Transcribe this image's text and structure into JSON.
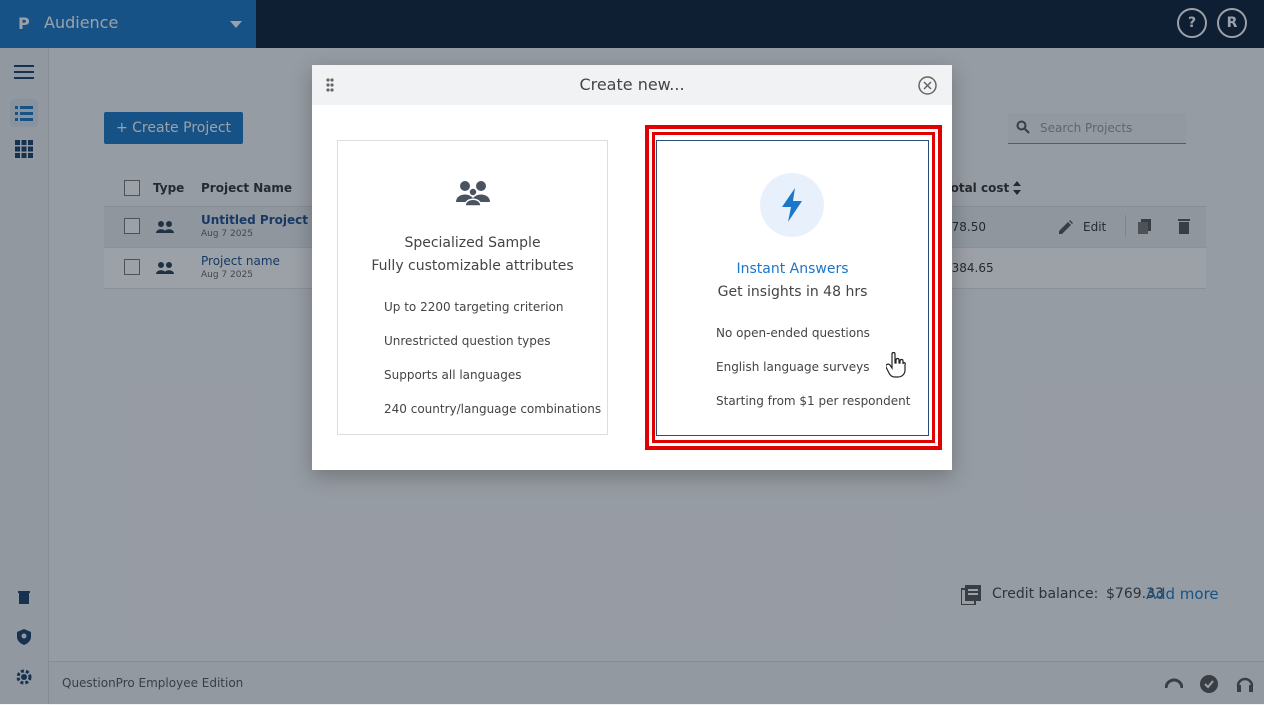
{
  "app": {
    "logo": "P",
    "title": "Audience",
    "help_label": "?",
    "user_initial": "R"
  },
  "toolbar": {
    "create_label": "+ Create Project",
    "search_placeholder": "Search Projects"
  },
  "table": {
    "headers": [
      "Type",
      "Project Name",
      "Total cost"
    ],
    "rows": [
      {
        "name": "Untitled Project",
        "date": "Aug 7 2025",
        "cost": "$78.50",
        "edit": "Edit"
      },
      {
        "name": "Project name",
        "date": "Aug 7 2025",
        "cost": "$384.65"
      }
    ]
  },
  "credit": {
    "label": "Credit balance:",
    "value": "$769.33",
    "action": "Add more"
  },
  "footer": {
    "edition": "QuestionPro Employee Edition"
  },
  "modal": {
    "title": "Create new...",
    "cards": [
      {
        "title": "Specialized Sample",
        "subtitle": "Fully customizable attributes",
        "features": [
          "Up to 2200 targeting criterion",
          "Unrestricted question types",
          "Supports all languages",
          "240 country/language combinations"
        ]
      },
      {
        "title": "Instant Answers",
        "subtitle": "Get insights in 48 hrs",
        "features": [
          "No open-ended questions",
          "English language surveys",
          "Starting from $1 per respondent"
        ]
      }
    ]
  },
  "colors": {
    "brand": "#1b77c9",
    "topbar": "#0b1f3a",
    "highlight": "#e00000",
    "link": "#1b77c9"
  }
}
